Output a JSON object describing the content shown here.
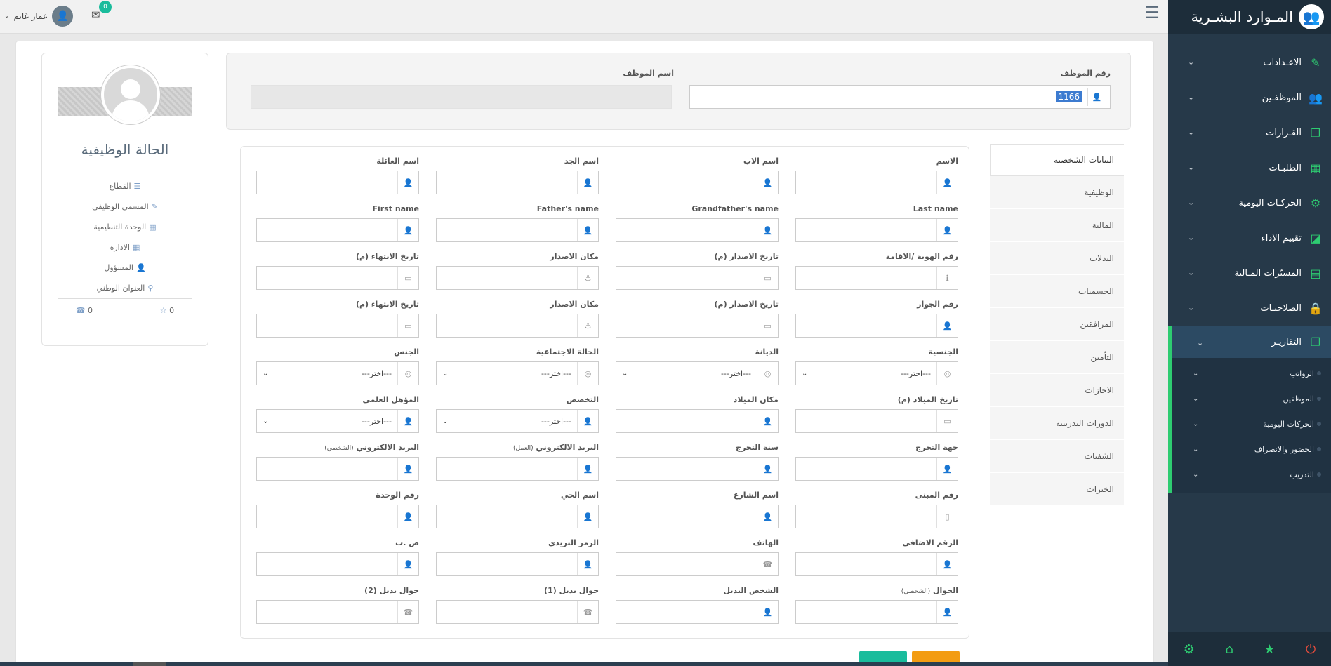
{
  "sidebar": {
    "brand": "المـوارد البشـرية",
    "items": [
      {
        "label": "الاعـدادات",
        "icon": "wrench-icon",
        "glyph": "✎"
      },
      {
        "label": "الموظفـين",
        "icon": "users-icon",
        "glyph": "👥"
      },
      {
        "label": "القـرارات",
        "icon": "copy-icon",
        "glyph": "❐"
      },
      {
        "label": "الطلبـات",
        "icon": "table-icon",
        "glyph": "▦"
      },
      {
        "label": "الحركـات اليومية",
        "icon": "gear-icon",
        "glyph": "⚙"
      },
      {
        "label": "تقييم الاداء",
        "icon": "bookmark-icon",
        "glyph": "◪"
      },
      {
        "label": "المسيّرات المـالية",
        "icon": "file-icon",
        "glyph": "▤"
      },
      {
        "label": "الصلاحيـات",
        "icon": "lock-icon",
        "glyph": "🔒"
      }
    ],
    "active_item": {
      "label": "التقاريـر",
      "icon": "copy-icon",
      "glyph": "❐"
    },
    "sub_items": [
      "الرواتب",
      "الموظفين",
      "الحركات اليومية",
      "الحضور والانصراف",
      "التدريب"
    ],
    "accent": "#2ecc71"
  },
  "topbar": {
    "user_name": "عمار غانم",
    "mail_count": "0"
  },
  "employee": {
    "number_label": "رقم الموظف",
    "number_value": "1166",
    "name_label": "اسم الموظف"
  },
  "profile": {
    "title": "الحالة الوظيفية",
    "items": [
      {
        "label": "القطاع",
        "icon": "list-icon",
        "glyph": "☰"
      },
      {
        "label": "المسمى الوظيفي",
        "icon": "pencil-icon",
        "glyph": "✎"
      },
      {
        "label": "الوحدة التنظيمية",
        "icon": "grid-icon",
        "glyph": "▦"
      },
      {
        "label": "الادارة",
        "icon": "th-icon",
        "glyph": "▦"
      },
      {
        "label": "المسؤول",
        "icon": "user-icon",
        "glyph": "👤"
      },
      {
        "label": "العنوان الوطني",
        "icon": "map-marker-icon",
        "glyph": "⚲"
      }
    ],
    "stat_star": "0",
    "stat_phone": "0"
  },
  "tabs": [
    "البيانات الشخصية",
    "الوظيفية",
    "المالية",
    "البدلات",
    "الحسميات",
    "المرافقين",
    "التأمين",
    "الاجازات",
    "الدورات التدريبية",
    "الشفتات",
    "الخبرات"
  ],
  "form": {
    "select_placeholder": "---اختر---",
    "fields": [
      {
        "label": "الاسم",
        "icon": "user-icon",
        "glyph": "👤",
        "type": "text"
      },
      {
        "label": "اسم الاب",
        "icon": "user-icon",
        "glyph": "👤",
        "type": "text"
      },
      {
        "label": "اسم الجد",
        "icon": "user-icon",
        "glyph": "👤",
        "type": "text"
      },
      {
        "label": "اسم العائلة",
        "icon": "user-icon",
        "glyph": "👤",
        "type": "text"
      },
      {
        "label": "Last name",
        "icon": "user-icon",
        "glyph": "👤",
        "type": "text"
      },
      {
        "label": "Grandfather's name",
        "icon": "user-icon",
        "glyph": "👤",
        "type": "text"
      },
      {
        "label": "Father's name",
        "icon": "user-icon",
        "glyph": "👤",
        "type": "text"
      },
      {
        "label": "First name",
        "icon": "user-icon",
        "glyph": "👤",
        "type": "text"
      },
      {
        "label": "رقم الهوية /الاقامة",
        "icon": "info-icon",
        "glyph": "ℹ",
        "type": "text"
      },
      {
        "label": "تاريخ الاصدار (م)",
        "icon": "calendar-icon",
        "glyph": "▭",
        "type": "text"
      },
      {
        "label": "مكان الاصدار",
        "icon": "anchor-icon",
        "glyph": "⚓",
        "type": "text"
      },
      {
        "label": "تاريخ الانتهاء (م)",
        "icon": "calendar-icon",
        "glyph": "▭",
        "type": "text"
      },
      {
        "label": "رقم الجواز",
        "icon": "user-icon",
        "glyph": "👤",
        "type": "text"
      },
      {
        "label": "تاريخ الاصدار (م)",
        "icon": "calendar-icon",
        "glyph": "▭",
        "type": "text"
      },
      {
        "label": "مكان الاصدار",
        "icon": "anchor-icon",
        "glyph": "⚓",
        "type": "text"
      },
      {
        "label": "تاريخ الانتهاء (م)",
        "icon": "calendar-icon",
        "glyph": "▭",
        "type": "text"
      },
      {
        "label": "الجنسية",
        "icon": "circle-icon",
        "glyph": "◎",
        "type": "select"
      },
      {
        "label": "الديانة",
        "icon": "circle-icon",
        "glyph": "◎",
        "type": "select"
      },
      {
        "label": "الحالة الاجتماعية",
        "icon": "circle-icon",
        "glyph": "◎",
        "type": "select"
      },
      {
        "label": "الجنس",
        "icon": "circle-icon",
        "glyph": "◎",
        "type": "select"
      },
      {
        "label": "تاريخ الميلاد (م)",
        "icon": "calendar-icon",
        "glyph": "▭",
        "type": "text"
      },
      {
        "label": "مكان الميلاد",
        "icon": "user-icon",
        "glyph": "👤",
        "type": "text"
      },
      {
        "label": "التخصص",
        "icon": "user-icon",
        "glyph": "👤",
        "type": "select"
      },
      {
        "label": "المؤهل العلمي",
        "icon": "user-icon",
        "glyph": "👤",
        "type": "select"
      },
      {
        "label": "جهة التخرج",
        "icon": "user-icon",
        "glyph": "👤",
        "type": "text"
      },
      {
        "label": "سنة التخرج",
        "icon": "user-icon",
        "glyph": "👤",
        "type": "text"
      },
      {
        "label": "البريد الالكتروني",
        "sub": "(العمل)",
        "icon": "user-icon",
        "glyph": "👤",
        "type": "text"
      },
      {
        "label": "البريد الالكتروني",
        "sub": "(الشخصي)",
        "icon": "user-icon",
        "glyph": "👤",
        "type": "text"
      },
      {
        "label": "رقم المبنى",
        "icon": "building-icon",
        "glyph": "▯",
        "type": "text"
      },
      {
        "label": "اسم الشارع",
        "icon": "user-icon",
        "glyph": "👤",
        "type": "text"
      },
      {
        "label": "اسم الحي",
        "icon": "user-icon",
        "glyph": "👤",
        "type": "text"
      },
      {
        "label": "رقم الوحدة",
        "icon": "user-icon",
        "glyph": "👤",
        "type": "text"
      },
      {
        "label": "الرقم الاضافي",
        "icon": "user-icon",
        "glyph": "👤",
        "type": "text"
      },
      {
        "label": "الهاتف",
        "icon": "phone-icon",
        "glyph": "☎",
        "type": "text"
      },
      {
        "label": "الرمز البريدي",
        "icon": "user-icon",
        "glyph": "👤",
        "type": "text"
      },
      {
        "label": "ص .ب",
        "icon": "user-icon",
        "glyph": "👤",
        "type": "text"
      },
      {
        "label": "الجوال",
        "sub": "(الشخصي)",
        "icon": "user-icon",
        "glyph": "👤",
        "type": "text"
      },
      {
        "label": "الشخص البديل",
        "icon": "user-icon",
        "glyph": "👤",
        "type": "text"
      },
      {
        "label": "جوال بديل (1)",
        "icon": "phone-icon",
        "glyph": "☎",
        "type": "text"
      },
      {
        "label": "جوال بديل (2)",
        "icon": "phone-icon",
        "glyph": "☎",
        "type": "text"
      }
    ]
  }
}
